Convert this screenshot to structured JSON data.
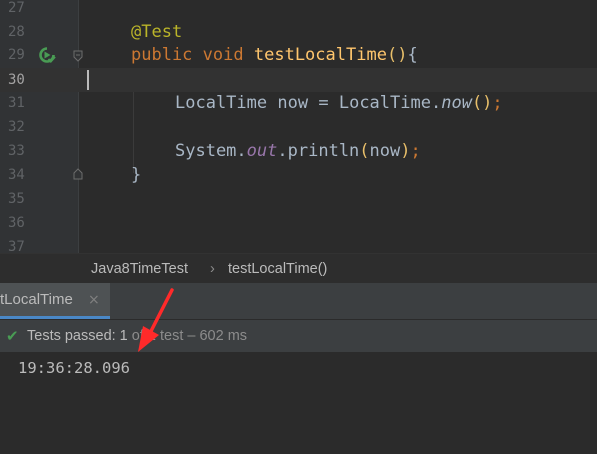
{
  "editor": {
    "lines": [
      {
        "num": "27"
      },
      {
        "num": "28",
        "annotation": "@Test"
      },
      {
        "num": "29",
        "kw_public": "public",
        "kw_void": "void",
        "method": "testLocalTime",
        "open": "(",
        "close": ")",
        "brace": "{"
      },
      {
        "num": "30"
      },
      {
        "num": "31",
        "type": "LocalTime",
        "var": "now",
        "eq": "=",
        "cls": "LocalTime",
        "dot": ".",
        "call": "now",
        "args": "()",
        "semi": ";"
      },
      {
        "num": "32"
      },
      {
        "num": "33",
        "obj": "System",
        "dot1": ".",
        "field": "out",
        "dot2": ".",
        "call": "println",
        "open": "(",
        "arg": "now",
        "close": ")",
        "semi": ";"
      },
      {
        "num": "34",
        "brace": "}"
      },
      {
        "num": "35"
      },
      {
        "num": "36"
      },
      {
        "num": "37"
      }
    ]
  },
  "breadcrumb": {
    "class_name": "Java8TimeTest",
    "separator": "›",
    "method_name": "testLocalTime()"
  },
  "run_panel": {
    "tab_label": "tLocalTime",
    "tab_close": "×",
    "status_main": "Tests passed: 1",
    "status_detail": " of 1 test – 602 ms",
    "console_output": "19:36:28.096"
  },
  "colors": {
    "accent_tab": "#4a88c7",
    "pass_green": "#499c54",
    "arrow_red": "#ff2a2a"
  },
  "icons": {
    "run": "run-test-icon",
    "fold": "fold-marker-icon",
    "check": "check-icon"
  }
}
